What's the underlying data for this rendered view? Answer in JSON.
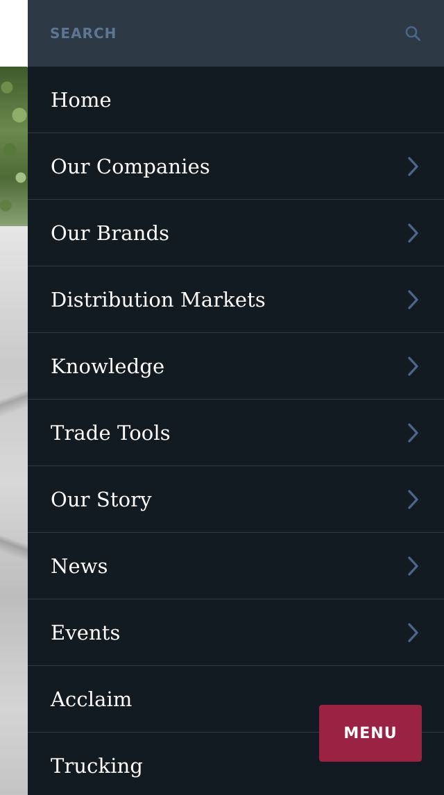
{
  "search": {
    "placeholder": "SEARCH",
    "icon": "search-icon"
  },
  "nav": {
    "items": [
      {
        "label": "Home",
        "has_submenu": false
      },
      {
        "label": "Our Companies",
        "has_submenu": true
      },
      {
        "label": "Our Brands",
        "has_submenu": true
      },
      {
        "label": "Distribution Markets",
        "has_submenu": true
      },
      {
        "label": "Knowledge",
        "has_submenu": true
      },
      {
        "label": "Trade Tools",
        "has_submenu": true
      },
      {
        "label": "Our Story",
        "has_submenu": true
      },
      {
        "label": "News",
        "has_submenu": true
      },
      {
        "label": "Events",
        "has_submenu": true
      },
      {
        "label": "Acclaim",
        "has_submenu": false
      },
      {
        "label": "Trucking",
        "has_submenu": false
      }
    ]
  },
  "menu_button": {
    "label": "MENU"
  },
  "colors": {
    "drawer_bg": "#121a22",
    "search_bg": "#2d3945",
    "accent": "#9a2243",
    "chevron": "#4b6584"
  }
}
